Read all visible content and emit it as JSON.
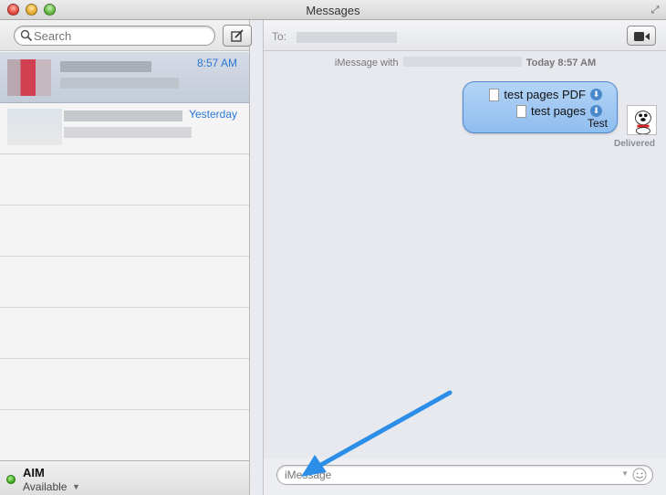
{
  "window": {
    "title": "Messages"
  },
  "sidebar": {
    "search_placeholder": "Search",
    "conversations": [
      {
        "time": "8:57 AM",
        "selected": true
      },
      {
        "time": "Yesterday",
        "selected": false
      }
    ],
    "status": {
      "account": "AIM",
      "availability": "Available"
    }
  },
  "chat": {
    "to_label": "To:",
    "meta_prefix": "iMessage with",
    "meta_time": "Today 8:57 AM",
    "message": {
      "attachments": [
        "test pages PDF",
        "test pages"
      ],
      "text": "Test",
      "status": "Delivered"
    },
    "input_placeholder": "iMessage"
  },
  "icons": {
    "search": "search-icon",
    "compose": "compose-icon",
    "video": "video-call-icon",
    "file": "document-icon",
    "download": "download-icon",
    "emoji": "smiley-icon"
  },
  "colors": {
    "accent_blue": "#2a78d4",
    "bubble_blue": "#9fc6f1",
    "status_green": "#33a11a",
    "annotation_arrow": "#2d8ee8"
  }
}
